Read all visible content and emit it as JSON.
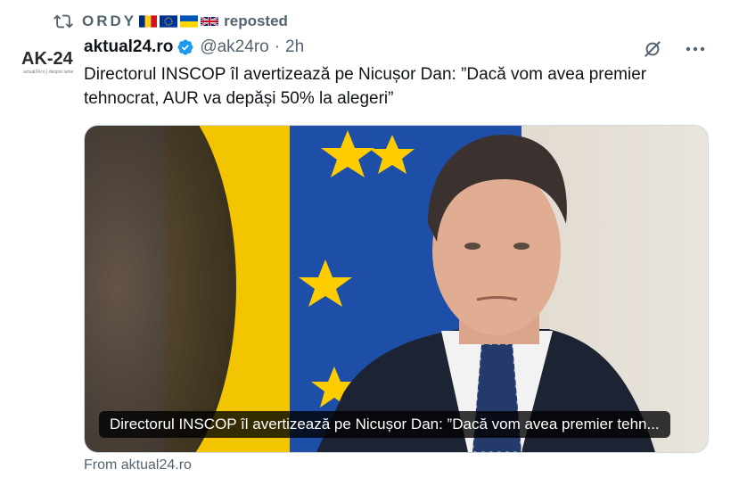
{
  "repost": {
    "user": "ORDY",
    "flags": [
      "romania-flag",
      "eu-flag",
      "ukraine-flag",
      "uk-flag"
    ],
    "label": "reposted"
  },
  "tweet": {
    "display_name": "aktual24.ro",
    "handle": "@ak24ro",
    "separator": "·",
    "time": "2h",
    "text": "Directorul INSCOP îl avertizează pe Nicușor Dan: ”Dacă vom avea premier tehnocrat, AUR va depăși 50% la alegeri”",
    "avatar": {
      "text": "AK-24",
      "tagline": "actual24.ro | despre lume"
    },
    "card": {
      "caption": "Directorul INSCOP îl avertizează pe Nicușor Dan: ”Dacă vom avea premier tehn...",
      "source": "From aktual24.ro"
    }
  },
  "colors": {
    "secondary_text": "#536471",
    "verified_blue": "#1d9bf0",
    "eu_blue": "#1e4fa8",
    "flag_yellow": "#f2c500"
  },
  "icons": [
    "repost-icon",
    "verified-icon",
    "grok-icon",
    "more-icon"
  ]
}
